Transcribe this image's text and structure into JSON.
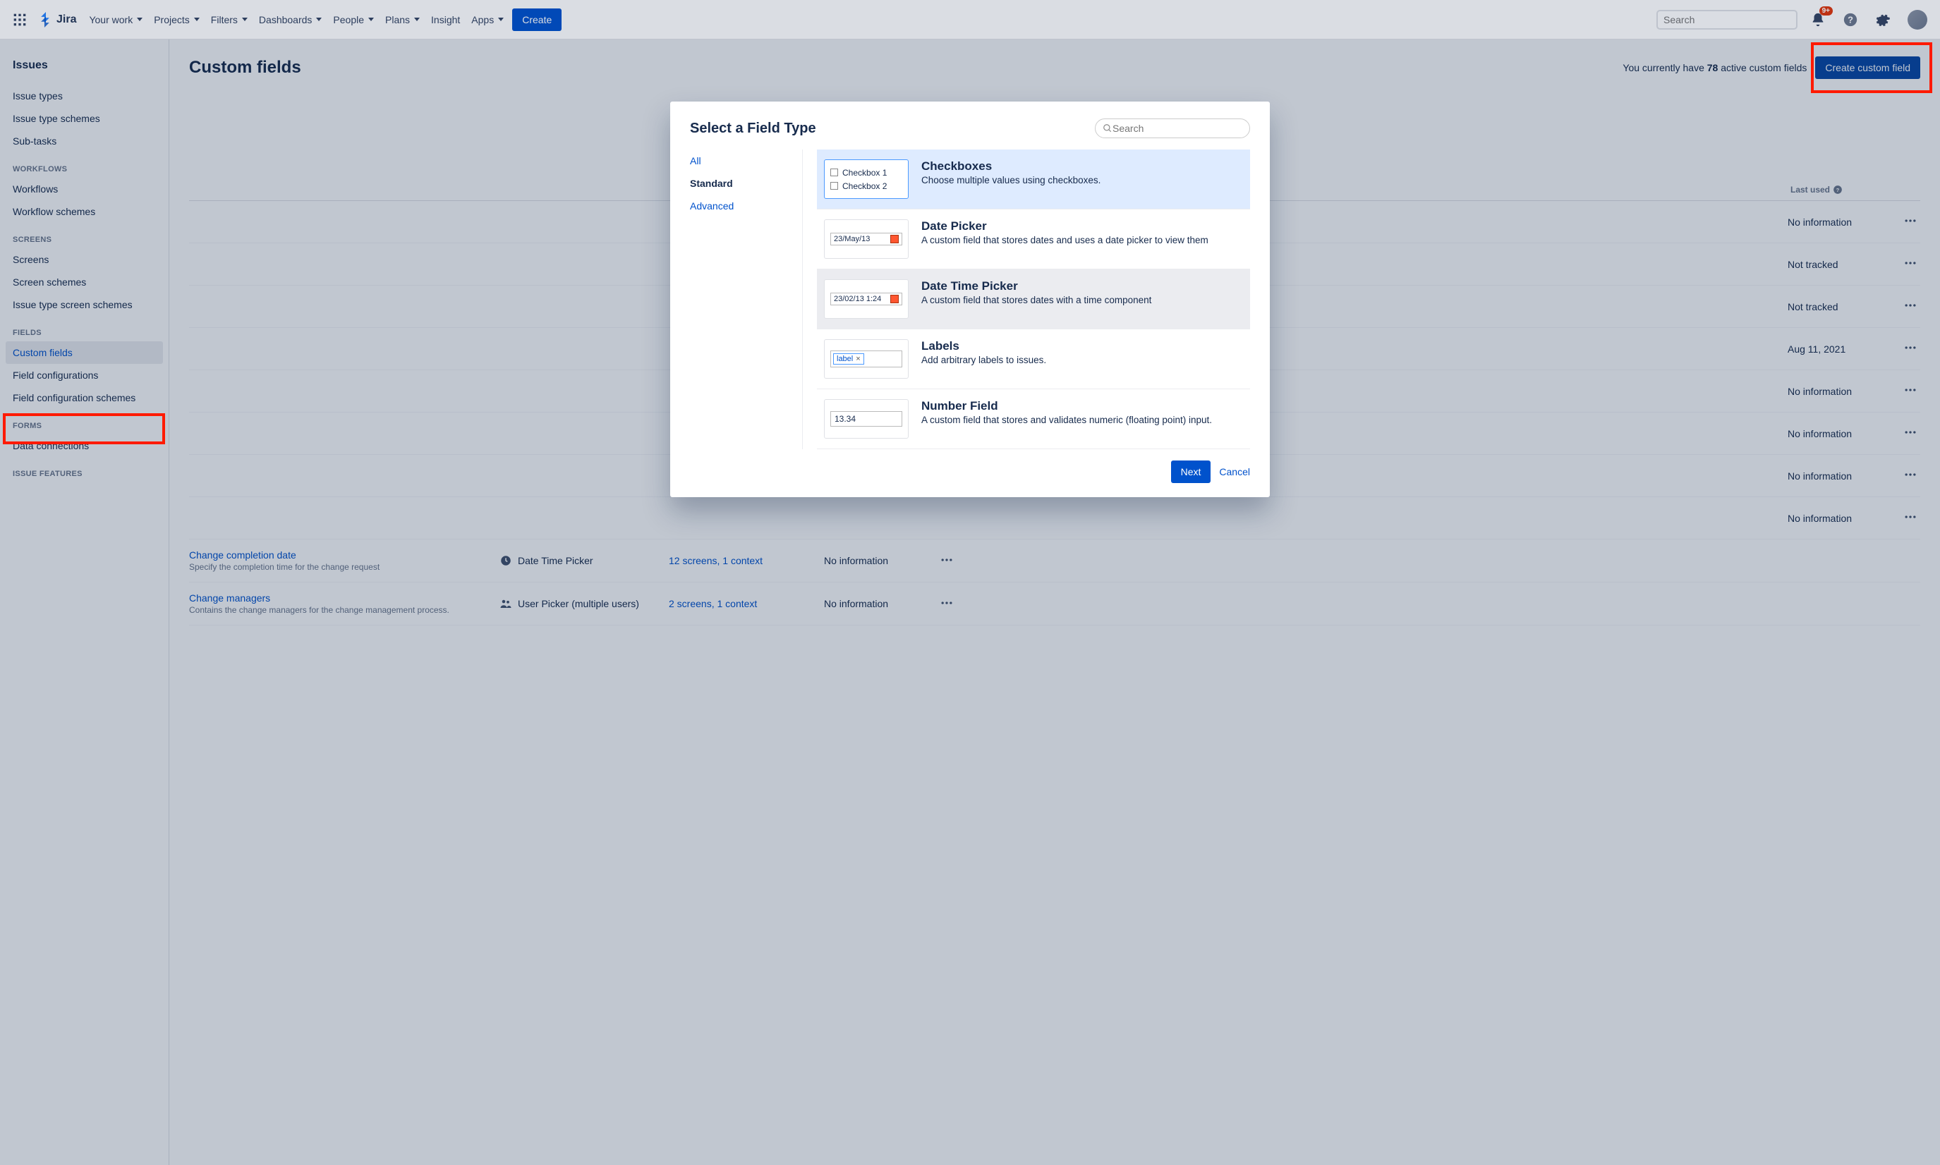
{
  "topnav": {
    "logo_text": "Jira",
    "items": [
      "Your work",
      "Projects",
      "Filters",
      "Dashboards",
      "People",
      "Plans",
      "Insight",
      "Apps"
    ],
    "create": "Create",
    "search_placeholder": "Search",
    "badge": "9+"
  },
  "sidebar": {
    "title": "Issues",
    "groups": [
      {
        "header": null,
        "items": [
          "Issue types",
          "Issue type schemes",
          "Sub-tasks"
        ]
      },
      {
        "header": "WORKFLOWS",
        "items": [
          "Workflows",
          "Workflow schemes"
        ]
      },
      {
        "header": "SCREENS",
        "items": [
          "Screens",
          "Screen schemes",
          "Issue type screen schemes"
        ]
      },
      {
        "header": "FIELDS",
        "items": [
          "Custom fields",
          "Field configurations",
          "Field configuration schemes"
        ],
        "active": "Custom fields"
      },
      {
        "header": "FORMS",
        "items": [
          "Data connections"
        ]
      },
      {
        "header": "ISSUE FEATURES",
        "items": []
      }
    ]
  },
  "page": {
    "title": "Custom fields",
    "count_prefix": "You currently have ",
    "count": "78",
    "count_suffix": " active custom fields",
    "create_btn": "Create custom field",
    "th_lastused": "Last used"
  },
  "rows": [
    {
      "last": "No information"
    },
    {
      "last": "Not tracked"
    },
    {
      "last": "Not tracked"
    },
    {
      "last": "Aug 11, 2021"
    },
    {
      "last": "No information"
    },
    {
      "last": "No information"
    },
    {
      "last": "No information"
    },
    {
      "last": "No information"
    }
  ],
  "full_row_1": {
    "name": "Change completion date",
    "desc": "Specify the completion time for the change request",
    "type": "Date Time Picker",
    "screens": "12 screens, 1 context",
    "last": "No information"
  },
  "full_row_2": {
    "name": "Change managers",
    "desc": "Contains the change managers for the change management process.",
    "type": "User Picker (multiple users)",
    "screens": "2 screens, 1 context",
    "last": "No information"
  },
  "modal": {
    "title": "Select a Field Type",
    "search_placeholder": "Search",
    "categories": [
      "All",
      "Standard",
      "Advanced"
    ],
    "active_cat": "Standard",
    "next": "Next",
    "cancel": "Cancel",
    "types": [
      {
        "id": "checkboxes",
        "name": "Checkboxes",
        "desc": "Choose multiple values using checkboxes.",
        "preview": {
          "kind": "checkbox",
          "items": [
            "Checkbox 1",
            "Checkbox 2"
          ]
        },
        "state": "selected"
      },
      {
        "id": "date-picker",
        "name": "Date Picker",
        "desc": "A custom field that stores dates and uses a date picker to view them",
        "preview": {
          "kind": "date",
          "value": "23/May/13"
        }
      },
      {
        "id": "date-time-picker",
        "name": "Date Time Picker",
        "desc": "A custom field that stores dates with a time component",
        "preview": {
          "kind": "date",
          "value": "23/02/13 1:24"
        },
        "state": "hovered"
      },
      {
        "id": "labels",
        "name": "Labels",
        "desc": "Add arbitrary labels to issues.",
        "preview": {
          "kind": "label",
          "value": "label"
        }
      },
      {
        "id": "number-field",
        "name": "Number Field",
        "desc": "A custom field that stores and validates numeric (floating point) input.",
        "preview": {
          "kind": "number",
          "value": "13.34"
        }
      }
    ]
  }
}
